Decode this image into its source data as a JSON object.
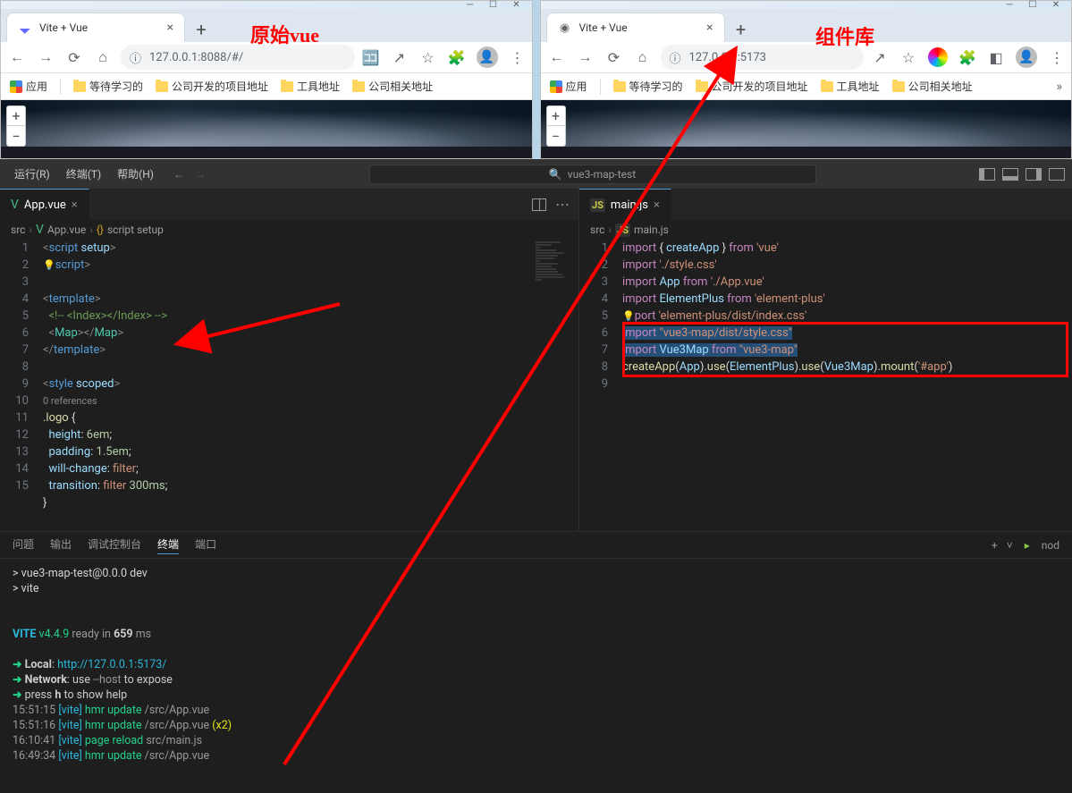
{
  "annotations": {
    "left_label": "原始vue",
    "right_label": "组件库"
  },
  "browser_left": {
    "tab_title": "Vite + Vue",
    "url": "127.0.0.1:8088/#/",
    "bookmarks": {
      "apps": "应用",
      "items": [
        "等待学习的",
        "公司开发的项目地址",
        "工具地址",
        "公司相关地址"
      ]
    }
  },
  "browser_right": {
    "tab_title": "Vite + Vue",
    "url": "127.0.0.1:5173",
    "bookmarks": {
      "apps": "应用",
      "items": [
        "等待学习的",
        "公司开发的项目地址",
        "工具地址",
        "公司相关地址"
      ]
    }
  },
  "vscode": {
    "menu": {
      "run": "运行(R)",
      "terminal": "终端(T)",
      "help": "帮助(H)"
    },
    "search_placeholder": "vue3-map-test",
    "editor_left": {
      "tab": "App.vue",
      "breadcrumb": [
        "src",
        "App.vue",
        "{} script setup"
      ],
      "references": "0 references",
      "lines": [
        {
          "n": 1,
          "html": "<span class='c-gray'>&lt;</span><span class='c-blue'>script</span> <span class='c-lightblue'>setup</span><span class='c-gray'>&gt;</span>"
        },
        {
          "n": 2,
          "html": "<span class='bulb'>💡</span><span class='c-blue'>script</span><span class='c-gray'>&gt;</span>"
        },
        {
          "n": 3,
          "html": ""
        },
        {
          "n": 4,
          "html": "<span class='c-gray'>&lt;</span><span class='c-blue'>template</span><span class='c-gray'>&gt;</span>"
        },
        {
          "n": 5,
          "html": "  <span class='c-green'>&lt;!-- &lt;Index&gt;&lt;/Index&gt; --&gt;</span>"
        },
        {
          "n": 6,
          "html": "  <span class='c-gray'>&lt;</span><span class='c-teal'>Map</span><span class='c-gray'>&gt;&lt;/</span><span class='c-teal'>Map</span><span class='c-gray'>&gt;</span>"
        },
        {
          "n": 7,
          "html": "<span class='c-gray'>&lt;/</span><span class='c-blue'>template</span><span class='c-gray'>&gt;</span>"
        },
        {
          "n": 8,
          "html": ""
        },
        {
          "n": 9,
          "html": "<span class='c-gray'>&lt;</span><span class='c-blue'>style</span> <span class='c-lightblue'>scoped</span><span class='c-gray'>&gt;</span>"
        },
        {
          "n": "",
          "html": "<span class='references'>0 references</span>"
        },
        {
          "n": 10,
          "html": "<span class='c-yellow'>.logo</span> <span class='c-white'>{</span>"
        },
        {
          "n": 11,
          "html": "  <span class='c-lightblue'>height</span><span class='c-white'>:</span> <span class='c-num'>6em</span><span class='c-white'>;</span>"
        },
        {
          "n": 12,
          "html": "  <span class='c-lightblue'>padding</span><span class='c-white'>:</span> <span class='c-num'>1.5em</span><span class='c-white'>;</span>"
        },
        {
          "n": 13,
          "html": "  <span class='c-lightblue'>will-change</span><span class='c-white'>:</span> <span class='c-orange'>filter</span><span class='c-white'>;</span>"
        },
        {
          "n": 14,
          "html": "  <span class='c-lightblue'>transition</span><span class='c-white'>:</span> <span class='c-orange'>filter</span> <span class='c-num'>300ms</span><span class='c-white'>;</span>"
        },
        {
          "n": 15,
          "html": "<span class='c-white'>}</span>"
        }
      ]
    },
    "editor_right": {
      "tab": "main.js",
      "breadcrumb": [
        "src",
        "main.js"
      ],
      "lines": [
        {
          "n": 1,
          "html": "<span class='c-purple'>import</span> <span class='c-white'>{ </span><span class='c-lightblue'>createApp</span><span class='c-white'> }</span> <span class='c-purple'>from</span> <span class='c-orange'>'vue'</span>"
        },
        {
          "n": 2,
          "html": "<span class='c-purple'>import</span> <span class='c-orange'>'./style.css'</span>"
        },
        {
          "n": 3,
          "html": "<span class='c-purple'>import</span> <span class='c-lightblue'>App</span> <span class='c-purple'>from</span> <span class='c-orange'>'./App.vue'</span>"
        },
        {
          "n": 4,
          "html": "<span class='c-purple'>import</span> <span class='c-lightblue'>ElementPlus</span> <span class='c-purple'>from</span> <span class='c-orange'>'element-plus'</span>"
        },
        {
          "n": 5,
          "html": "<span class='bulb'>💡</span><span class='c-purple'>port</span> <span class='c-orange'>'element-plus/dist/index.css'</span>"
        },
        {
          "n": 6,
          "html": "<span class='code-select'><span class='c-purple'>import</span> <span class='c-orange'>\"vue3-map/dist/style.css\"</span></span>"
        },
        {
          "n": 7,
          "html": "<span class='code-select'><span class='c-purple'>import</span> <span class='c-lightblue'>Vue3Map</span> <span class='c-purple'>from</span> <span class='c-orange'>\"vue3-map\"</span></span>"
        },
        {
          "n": 8,
          "html": "<span class='c-yellow'>createApp</span><span class='c-white'>(</span><span class='c-lightblue'>App</span><span class='c-white'>).</span><span class='c-yellow'>use</span><span class='c-white'>(</span><span class='c-lightblue'>ElementPlus</span><span class='c-white'>).</span><span class='c-yellow'>use</span><span class='c-white'>(</span><span class='c-lightblue'>Vue3Map</span><span class='c-white'>).</span><span class='c-yellow'>mount</span><span class='c-white'>(</span><span class='c-orange'>'#app'</span><span class='c-white'>)</span>"
        },
        {
          "n": 9,
          "html": ""
        }
      ]
    },
    "terminal": {
      "tabs": {
        "problems": "问题",
        "output": "输出",
        "debug": "调试控制台",
        "terminal": "终端",
        "ports": "端口"
      },
      "right_label": "nod",
      "lines": [
        "<span class='c-white'>&gt; vue3-map-test@0.0.0 dev</span>",
        "<span class='c-white'>&gt; vite</span>",
        "",
        "",
        "  <span class='cyan bold'>VITE</span> <span class='green'>v4.4.9</span>  <span class='dim'>ready in</span> <span class='bold'>659</span> <span class='dim'>ms</span>",
        "",
        "  <span class='arrow'>➜</span>  <span class='bold'>Local</span>:   <span class='cyan'>http://127.0.0.1:5173/</span>",
        "  <span class='arrow'>➜</span>  <span class='bold'>Network</span>: use <span class='dim'>--host</span> to expose",
        "  <span class='arrow'>➜</span>  press <span class='bold'>h</span> to show help",
        "<span class='dim'>15:51:15</span> <span class='cyan'>[vite]</span> <span class='green'>hmr update</span> <span class='dim'>/src/App.vue</span>",
        "<span class='dim'>15:51:16</span> <span class='cyan'>[vite]</span> <span class='green'>hmr update</span> <span class='dim'>/src/App.vue</span> <span class='yellow'>(x2)</span>",
        "<span class='dim'>16:10:41</span> <span class='cyan'>[vite]</span> <span class='green'>page reload</span> <span class='dim'>src/main.js</span>",
        "<span class='dim'>16:49:34</span> <span class='cyan'>[vite]</span> <span class='green'>hmr update</span> <span class='dim'>/src/App.vue</span>"
      ]
    }
  }
}
